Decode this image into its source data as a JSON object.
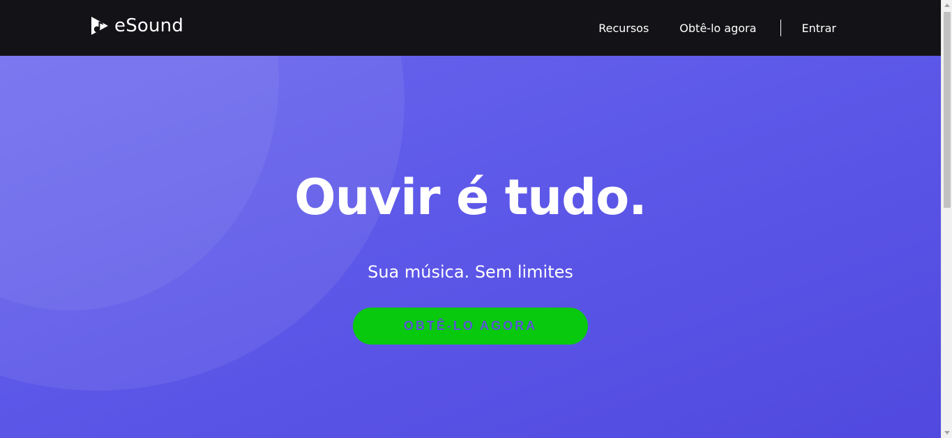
{
  "header": {
    "logo_text": "eSound",
    "logo_icon": "music-note-icon",
    "nav": {
      "recursos": "Recursos",
      "get_it": "Obtê-lo agora",
      "login": "Entrar"
    }
  },
  "hero": {
    "title": "Ouvir é tudo.",
    "subtitle": "Sua música. Sem limites",
    "cta_label": "OBTÊ-LO AGORA"
  },
  "colors": {
    "header_bg": "#131317",
    "hero_bg": "#5d58e8",
    "cta_bg": "#08c90d",
    "cta_text": "#5b55d6",
    "text": "#ffffff"
  }
}
